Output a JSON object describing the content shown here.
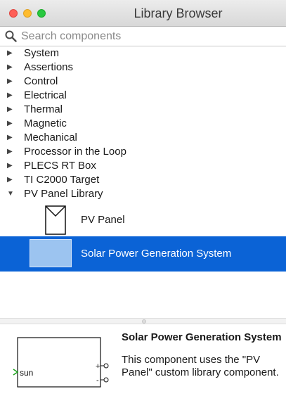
{
  "window": {
    "title": "Library Browser"
  },
  "search": {
    "placeholder": "Search components",
    "value": ""
  },
  "tree": {
    "items": [
      {
        "label": "System",
        "expanded": false
      },
      {
        "label": "Assertions",
        "expanded": false
      },
      {
        "label": "Control",
        "expanded": false
      },
      {
        "label": "Electrical",
        "expanded": false
      },
      {
        "label": "Thermal",
        "expanded": false
      },
      {
        "label": "Magnetic",
        "expanded": false
      },
      {
        "label": "Mechanical",
        "expanded": false
      },
      {
        "label": "Processor in the Loop",
        "expanded": false
      },
      {
        "label": "PLECS RT Box",
        "expanded": false
      },
      {
        "label": "TI C2000 Target",
        "expanded": false
      },
      {
        "label": "PV Panel Library",
        "expanded": true
      }
    ],
    "collapsed_arrow": "▶",
    "expanded_arrow": "▼",
    "children": [
      {
        "label": "PV Panel",
        "selected": false,
        "icon": "pv-panel-icon"
      },
      {
        "label": "Solar Power Generation System",
        "selected": true,
        "icon": "subsystem-thumbnail-icon"
      }
    ]
  },
  "preview": {
    "title": "Solar Power Generation System",
    "description": "This component uses the \"PV Panel\" custom library component.",
    "port_in_label": "sun",
    "port_plus": "+",
    "port_minus": "-"
  },
  "colors": {
    "selection": "#0b63d6",
    "selection_text": "#ffffff",
    "thumbnail_fill": "#9cc4f0",
    "port_input": "#1aa01a"
  }
}
